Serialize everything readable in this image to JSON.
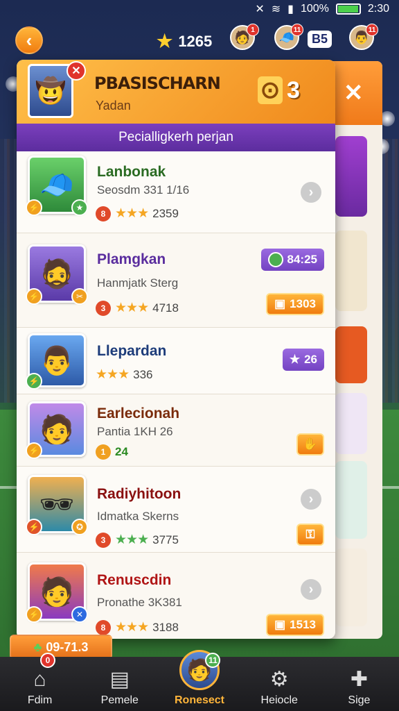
{
  "status_bar": {
    "battery": "100%",
    "time": "2:30"
  },
  "top_bar": {
    "stars": "1265",
    "level": "B5",
    "badges": [
      "1",
      "11",
      "11"
    ]
  },
  "panel": {
    "title": "PBASISCHARN",
    "subtitle": "Yadan",
    "code": "3",
    "section": "Pecialligkerh perjan"
  },
  "players": [
    {
      "name": "Lanbonak",
      "sub": "Seosdm 331 1/16",
      "level": "8",
      "stars": "★★★",
      "score": "2359",
      "name_color": "#2a6b22",
      "avatar_color": "#3fa54a",
      "avatar_emoji": "🧢",
      "action": "chevron",
      "action_label": ""
    },
    {
      "name": "Plamgkan",
      "sub": "Hanmjatk Sterg",
      "level": "3",
      "stars": "★★★",
      "score": "4718",
      "name_color": "#5a2d9e",
      "avatar_color": "#7b5fc6",
      "avatar_emoji": "🧔",
      "action": "pill-purple",
      "action_label": "84:25",
      "action2_label": "1303"
    },
    {
      "name": "Llepardan",
      "sub": "",
      "level": "",
      "stars": "★★★",
      "score": "336",
      "name_color": "#1d3c7a",
      "avatar_color": "#4f8ee8",
      "avatar_emoji": "👨",
      "action": "pill-purple",
      "action_label": "26"
    },
    {
      "name": "Earlecionah",
      "sub": "Pantia 1KH 26",
      "level": "1",
      "stars": "",
      "score": "24",
      "name_color": "#7a2b0a",
      "avatar_color": "#9a5ae0",
      "avatar_emoji": "🧑",
      "action": "pill-orange",
      "action_label": ""
    },
    {
      "name": "Radiyhitoon",
      "sub": "Idmatka Skerns",
      "level": "3",
      "stars": "★★★",
      "score": "3775",
      "name_color": "#8a1010",
      "avatar_color": "#f0a040",
      "avatar_emoji": "🕶",
      "action": "chevron",
      "action_label": "",
      "action2_label": ""
    },
    {
      "name": "Renuscdin",
      "sub": "Pronathe 3K381",
      "level": "8",
      "stars": "★★★",
      "score": "3188",
      "name_color": "#b01515",
      "avatar_color": "#e8603a",
      "avatar_emoji": "🧑",
      "action": "chevron",
      "action_label": "",
      "action2_label": "1513"
    }
  ],
  "bottom_chip": "09-71.3",
  "nav": [
    {
      "label": "Fdim",
      "icon": "home-icon",
      "badge": "0"
    },
    {
      "label": "Pemele",
      "icon": "clipboard-icon",
      "badge": ""
    },
    {
      "label": "Ronesect",
      "icon": "avatar-icon",
      "badge": "11"
    },
    {
      "label": "Heiocle",
      "icon": "gear-icon",
      "badge": ""
    },
    {
      "label": "Sige",
      "icon": "puzzle-icon",
      "badge": ""
    }
  ],
  "colors": {
    "accent": "#f07c0f",
    "purple": "#5c2d9e",
    "modal_bg": "#fbf8f2"
  }
}
